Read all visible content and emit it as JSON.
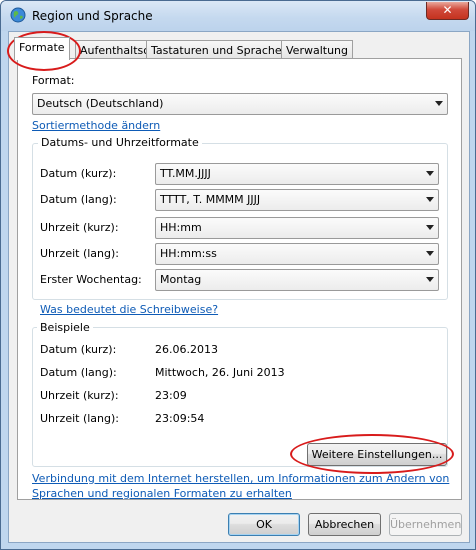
{
  "window": {
    "title": "Region und Sprache",
    "close_label": "✕"
  },
  "tabs": [
    {
      "label": "Formate",
      "active": true
    },
    {
      "label": "Aufenthaltsort"
    },
    {
      "label": "Tastaturen und Sprachen"
    },
    {
      "label": "Verwaltung"
    }
  ],
  "format": {
    "label": "Format:",
    "value": "Deutsch (Deutschland)",
    "sort_link": "Sortiermethode ändern"
  },
  "datetime": {
    "group_title": "Datums- und Uhrzeitformate",
    "rows": [
      {
        "label": "Datum (kurz):",
        "value": "TT.MM.JJJJ"
      },
      {
        "label": "Datum (lang):",
        "value": "TTTT, T. MMMM JJJJ"
      },
      {
        "label": "Uhrzeit (kurz):",
        "value": "HH:mm"
      },
      {
        "label": "Uhrzeit (lang):",
        "value": "HH:mm:ss"
      },
      {
        "label": "Erster Wochentag:",
        "value": "Montag"
      }
    ],
    "notation_link": "Was bedeutet die Schreibweise?"
  },
  "examples": {
    "group_title": "Beispiele",
    "rows": [
      {
        "label": "Datum (kurz):",
        "value": "26.06.2013"
      },
      {
        "label": "Datum (lang):",
        "value": "Mittwoch, 26. Juni 2013"
      },
      {
        "label": "Uhrzeit (kurz):",
        "value": "23:09"
      },
      {
        "label": "Uhrzeit (lang):",
        "value": "23:09:54"
      }
    ]
  },
  "more_settings_label": "Weitere Einstellungen...",
  "internet_link": "Verbindung mit dem Internet herstellen, um Informationen zum Ändern von Sprachen und regionalen Formaten zu erhalten",
  "buttons": {
    "ok": "OK",
    "cancel": "Abbrechen",
    "apply": "Übernehmen"
  },
  "colors": {
    "link": "#0e5bb6",
    "highlight_ellipse": "#d81b1b"
  }
}
